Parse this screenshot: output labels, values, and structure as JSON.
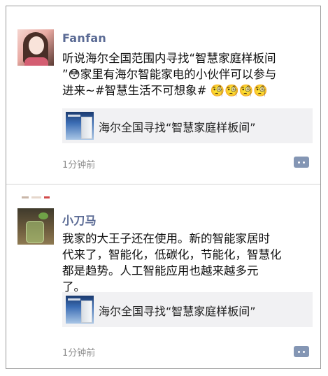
{
  "posts": [
    {
      "author": "Fanfan",
      "text_lines": [
        "听说海尔全国范围内寻找“智慧家庭样板间",
        "”😳家里有海尔智能家电的小伙伴可以参与",
        "进来~#智慧生活不可想象# 🧐🧐🧐🧐"
      ],
      "link_title": "海尔全国寻找“智慧家庭样板间”",
      "time": "1分钟前"
    },
    {
      "author": "小刀马",
      "text_lines": [
        "我家的大王子还在使用。新的智能家居时",
        "代来了，智能化，低碳化，节能化，智慧化",
        "都是趋势。人工智能应用也越来越多元",
        "了。"
      ],
      "link_title": "海尔全国寻找“智慧家庭样板间”",
      "time": "1分钟前"
    }
  ],
  "colors": {
    "author": "#5a6a94",
    "comment_button": "#8496b4",
    "card_bg": "#f1f1f3"
  },
  "icons": {
    "comment": "comment-dots-icon"
  }
}
